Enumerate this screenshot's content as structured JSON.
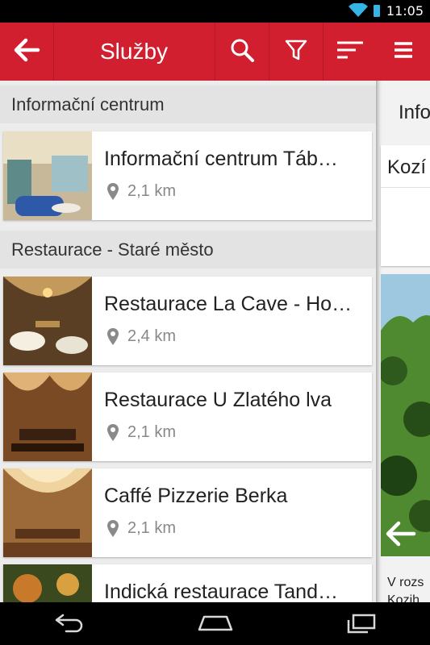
{
  "status": {
    "time": "11:05",
    "wifi_icon": "wifi-icon",
    "battery_icon": "battery-icon"
  },
  "header": {
    "title": "Služby",
    "back_icon": "arrow-left-icon",
    "search_icon": "search-icon",
    "filter_icon": "filter-icon",
    "sort_icon": "sort-icon",
    "color": "#d11f2f"
  },
  "sections": [
    {
      "title": "Informační centrum"
    },
    {
      "title": "Restaurace - Staré město"
    }
  ],
  "items": [
    {
      "name": "Informační centrum Táb…",
      "distance": "2,1 km"
    },
    {
      "name": "Restaurace La Cave - Ho…",
      "distance": "2,4 km"
    },
    {
      "name": "Restaurace U Zlatého lva",
      "distance": "2,1 km"
    },
    {
      "name": "Caffé Pizzerie Berka",
      "distance": "2,1 km"
    },
    {
      "name": "Indická restaurace Tand…",
      "distance": ""
    }
  ],
  "right_panel": {
    "menu_icon": "menu-icon",
    "header_text": "Info",
    "card_title": "Kozí",
    "desc_line1": "V rozs",
    "desc_line2": "Kozih"
  },
  "nav": {
    "back_icon": "nav-back-icon",
    "home_icon": "nav-home-icon",
    "recents_icon": "nav-recents-icon"
  }
}
